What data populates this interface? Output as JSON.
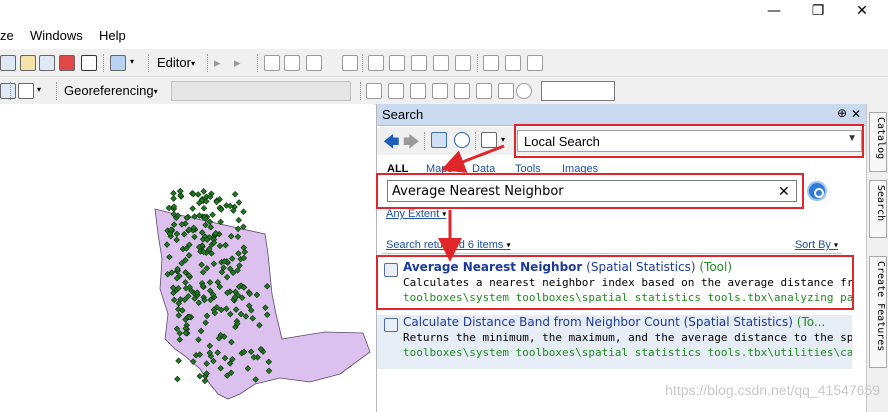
{
  "window": {
    "minimize_glyph": "—",
    "restore_glyph": "❐",
    "close_glyph": "✕"
  },
  "menubar": {
    "items": [
      "ze",
      "Windows",
      "Help"
    ]
  },
  "toolbar1": {
    "editor_label": "Editor",
    "dropdown_glyph": "▾"
  },
  "toolbar2": {
    "georef_label": "Georeferencing",
    "layer_dropdown_value": "",
    "scale_value": ""
  },
  "search": {
    "title": "Search",
    "pin_glyph": "⊕",
    "close_glyph": "✕",
    "scope": "Local Search",
    "filters": [
      "ALL",
      "Maps",
      "Data",
      "Tools",
      "Images"
    ],
    "query": "Average Nearest Neighbor",
    "extent_label": "Any Extent",
    "results_label": "Search returned 6 items",
    "sort_label": "Sort By",
    "results": [
      {
        "title_bold": "Average Nearest Neighbor",
        "title_rest": "",
        "category": "(Spatial Statistics)",
        "type": "(Tool)",
        "description": "Calculates a nearest neighbor index based on the average distance fro...",
        "path": "toolboxes\\system toolboxes\\spatial statistics tools.tbx\\analyzing patterns\\a..."
      },
      {
        "title_bold": "",
        "title_rest": "Calculate Distance Band from Neighbor Count",
        "category": "(Spatial Statistics)",
        "type": "(To...",
        "description": "Returns the minimum, the maximum, and the average distance to the spe...",
        "path": "toolboxes\\system toolboxes\\spatial statistics tools.tbx\\utilities\\calculate dist..."
      }
    ]
  },
  "dock": {
    "tabs": [
      "Catalog",
      "Search",
      "Create Features"
    ]
  },
  "watermark": "https://blog.csdn.net/qq_41547659",
  "colors": {
    "annotation_red": "#e0252b",
    "polygon_fill": "#dcc1ee",
    "point_fill": "#1f7a1f",
    "link_blue": "#1e50a2",
    "header_blue": "#c9daf0"
  }
}
